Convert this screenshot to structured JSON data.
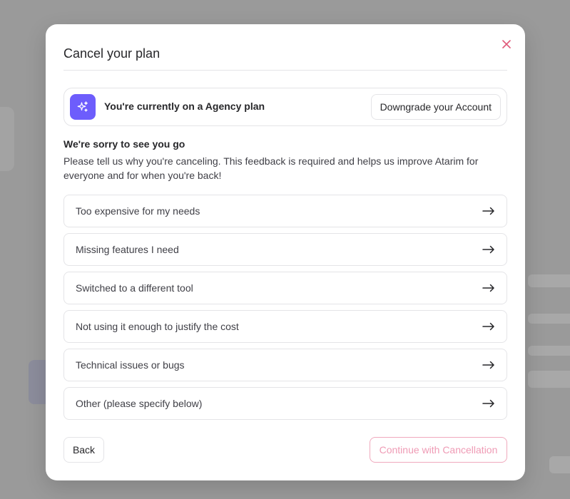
{
  "modal": {
    "title": "Cancel your plan",
    "close_icon": "close-icon"
  },
  "plan": {
    "icon": "sparkles-icon",
    "text": "You're currently on a Agency plan",
    "downgrade_label": "Downgrade your Account"
  },
  "feedback": {
    "title": "We're sorry to see you go",
    "description": "Please tell us why you're canceling. This feedback is required and helps us improve Atarim for everyone and for when you're back!"
  },
  "reasons": [
    {
      "label": "Too expensive for my needs"
    },
    {
      "label": "Missing features I need"
    },
    {
      "label": "Switched to a different tool"
    },
    {
      "label": "Not using it enough to justify the cost"
    },
    {
      "label": "Technical issues or bugs"
    },
    {
      "label": "Other (please specify below)"
    }
  ],
  "footer": {
    "back_label": "Back",
    "continue_label": "Continue with Cancellation"
  },
  "colors": {
    "accent": "#6d5dfc",
    "close": "#e05a7a",
    "continue_disabled": "#ef9bb5"
  }
}
